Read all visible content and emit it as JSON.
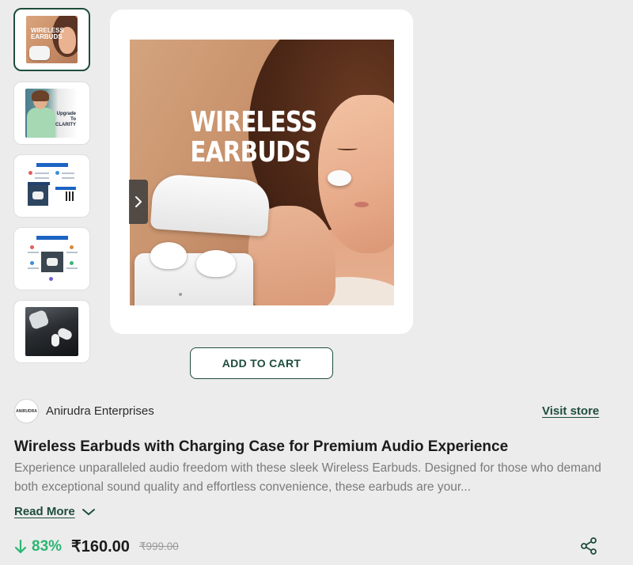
{
  "gallery": {
    "thumbnails": [
      {
        "name": "thumbnail-1",
        "overlay_text": "WIRELESS EARBUDS",
        "active": true
      },
      {
        "name": "thumbnail-2",
        "overlay_text": "Upgrade To CLARITY",
        "active": false
      },
      {
        "name": "thumbnail-3",
        "active": false
      },
      {
        "name": "thumbnail-4",
        "active": false
      },
      {
        "name": "thumbnail-5",
        "active": false
      }
    ],
    "hero_headline_line1": "WIRELESS",
    "hero_headline_line2": "EARBUDS",
    "next_icon": "chevron-right-icon"
  },
  "actions": {
    "add_to_cart_label": "ADD TO CART"
  },
  "seller": {
    "name": "Anirudra Enterprises",
    "logo_text": "ANIRUDRA",
    "visit_store_label": "Visit store"
  },
  "product": {
    "title": "Wireless Earbuds with Charging Case for Premium Audio Experience",
    "description": "Experience unparalleled audio freedom with these sleek Wireless Earbuds. Designed for those who demand both exceptional sound quality and effortless convenience, these earbuds are your...",
    "read_more_label": "Read More",
    "read_more_icon": "chevron-down-icon"
  },
  "pricing": {
    "discount_icon": "arrow-down-icon",
    "discount": "83%",
    "price": "₹160.00",
    "mrp": "₹999.00",
    "discount_color": "#2bb673"
  },
  "share_icon": "share-icon",
  "colors": {
    "accent": "#1f4d3c",
    "background": "#ececec"
  }
}
